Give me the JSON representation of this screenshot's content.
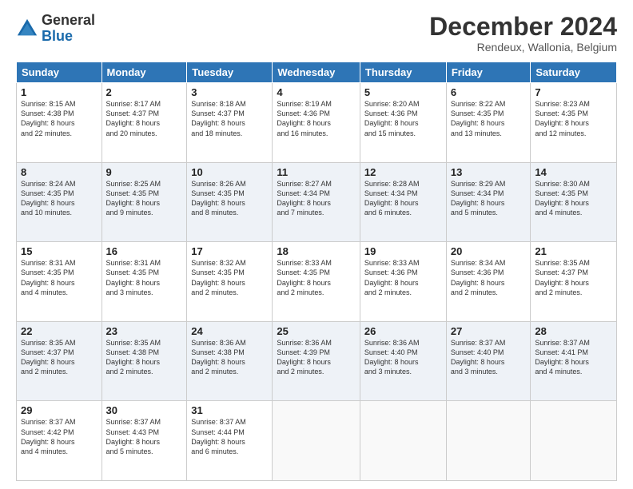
{
  "header": {
    "logo_general": "General",
    "logo_blue": "Blue",
    "month_year": "December 2024",
    "location": "Rendeux, Wallonia, Belgium"
  },
  "days_of_week": [
    "Sunday",
    "Monday",
    "Tuesday",
    "Wednesday",
    "Thursday",
    "Friday",
    "Saturday"
  ],
  "weeks": [
    [
      {
        "day": 1,
        "lines": [
          "Sunrise: 8:15 AM",
          "Sunset: 4:38 PM",
          "Daylight: 8 hours",
          "and 22 minutes."
        ]
      },
      {
        "day": 2,
        "lines": [
          "Sunrise: 8:17 AM",
          "Sunset: 4:37 PM",
          "Daylight: 8 hours",
          "and 20 minutes."
        ]
      },
      {
        "day": 3,
        "lines": [
          "Sunrise: 8:18 AM",
          "Sunset: 4:37 PM",
          "Daylight: 8 hours",
          "and 18 minutes."
        ]
      },
      {
        "day": 4,
        "lines": [
          "Sunrise: 8:19 AM",
          "Sunset: 4:36 PM",
          "Daylight: 8 hours",
          "and 16 minutes."
        ]
      },
      {
        "day": 5,
        "lines": [
          "Sunrise: 8:20 AM",
          "Sunset: 4:36 PM",
          "Daylight: 8 hours",
          "and 15 minutes."
        ]
      },
      {
        "day": 6,
        "lines": [
          "Sunrise: 8:22 AM",
          "Sunset: 4:35 PM",
          "Daylight: 8 hours",
          "and 13 minutes."
        ]
      },
      {
        "day": 7,
        "lines": [
          "Sunrise: 8:23 AM",
          "Sunset: 4:35 PM",
          "Daylight: 8 hours",
          "and 12 minutes."
        ]
      }
    ],
    [
      {
        "day": 8,
        "lines": [
          "Sunrise: 8:24 AM",
          "Sunset: 4:35 PM",
          "Daylight: 8 hours",
          "and 10 minutes."
        ]
      },
      {
        "day": 9,
        "lines": [
          "Sunrise: 8:25 AM",
          "Sunset: 4:35 PM",
          "Daylight: 8 hours",
          "and 9 minutes."
        ]
      },
      {
        "day": 10,
        "lines": [
          "Sunrise: 8:26 AM",
          "Sunset: 4:35 PM",
          "Daylight: 8 hours",
          "and 8 minutes."
        ]
      },
      {
        "day": 11,
        "lines": [
          "Sunrise: 8:27 AM",
          "Sunset: 4:34 PM",
          "Daylight: 8 hours",
          "and 7 minutes."
        ]
      },
      {
        "day": 12,
        "lines": [
          "Sunrise: 8:28 AM",
          "Sunset: 4:34 PM",
          "Daylight: 8 hours",
          "and 6 minutes."
        ]
      },
      {
        "day": 13,
        "lines": [
          "Sunrise: 8:29 AM",
          "Sunset: 4:34 PM",
          "Daylight: 8 hours",
          "and 5 minutes."
        ]
      },
      {
        "day": 14,
        "lines": [
          "Sunrise: 8:30 AM",
          "Sunset: 4:35 PM",
          "Daylight: 8 hours",
          "and 4 minutes."
        ]
      }
    ],
    [
      {
        "day": 15,
        "lines": [
          "Sunrise: 8:31 AM",
          "Sunset: 4:35 PM",
          "Daylight: 8 hours",
          "and 4 minutes."
        ]
      },
      {
        "day": 16,
        "lines": [
          "Sunrise: 8:31 AM",
          "Sunset: 4:35 PM",
          "Daylight: 8 hours",
          "and 3 minutes."
        ]
      },
      {
        "day": 17,
        "lines": [
          "Sunrise: 8:32 AM",
          "Sunset: 4:35 PM",
          "Daylight: 8 hours",
          "and 2 minutes."
        ]
      },
      {
        "day": 18,
        "lines": [
          "Sunrise: 8:33 AM",
          "Sunset: 4:35 PM",
          "Daylight: 8 hours",
          "and 2 minutes."
        ]
      },
      {
        "day": 19,
        "lines": [
          "Sunrise: 8:33 AM",
          "Sunset: 4:36 PM",
          "Daylight: 8 hours",
          "and 2 minutes."
        ]
      },
      {
        "day": 20,
        "lines": [
          "Sunrise: 8:34 AM",
          "Sunset: 4:36 PM",
          "Daylight: 8 hours",
          "and 2 minutes."
        ]
      },
      {
        "day": 21,
        "lines": [
          "Sunrise: 8:35 AM",
          "Sunset: 4:37 PM",
          "Daylight: 8 hours",
          "and 2 minutes."
        ]
      }
    ],
    [
      {
        "day": 22,
        "lines": [
          "Sunrise: 8:35 AM",
          "Sunset: 4:37 PM",
          "Daylight: 8 hours",
          "and 2 minutes."
        ]
      },
      {
        "day": 23,
        "lines": [
          "Sunrise: 8:35 AM",
          "Sunset: 4:38 PM",
          "Daylight: 8 hours",
          "and 2 minutes."
        ]
      },
      {
        "day": 24,
        "lines": [
          "Sunrise: 8:36 AM",
          "Sunset: 4:38 PM",
          "Daylight: 8 hours",
          "and 2 minutes."
        ]
      },
      {
        "day": 25,
        "lines": [
          "Sunrise: 8:36 AM",
          "Sunset: 4:39 PM",
          "Daylight: 8 hours",
          "and 2 minutes."
        ]
      },
      {
        "day": 26,
        "lines": [
          "Sunrise: 8:36 AM",
          "Sunset: 4:40 PM",
          "Daylight: 8 hours",
          "and 3 minutes."
        ]
      },
      {
        "day": 27,
        "lines": [
          "Sunrise: 8:37 AM",
          "Sunset: 4:40 PM",
          "Daylight: 8 hours",
          "and 3 minutes."
        ]
      },
      {
        "day": 28,
        "lines": [
          "Sunrise: 8:37 AM",
          "Sunset: 4:41 PM",
          "Daylight: 8 hours",
          "and 4 minutes."
        ]
      }
    ],
    [
      {
        "day": 29,
        "lines": [
          "Sunrise: 8:37 AM",
          "Sunset: 4:42 PM",
          "Daylight: 8 hours",
          "and 4 minutes."
        ]
      },
      {
        "day": 30,
        "lines": [
          "Sunrise: 8:37 AM",
          "Sunset: 4:43 PM",
          "Daylight: 8 hours",
          "and 5 minutes."
        ]
      },
      {
        "day": 31,
        "lines": [
          "Sunrise: 8:37 AM",
          "Sunset: 4:44 PM",
          "Daylight: 8 hours",
          "and 6 minutes."
        ]
      },
      null,
      null,
      null,
      null
    ]
  ]
}
